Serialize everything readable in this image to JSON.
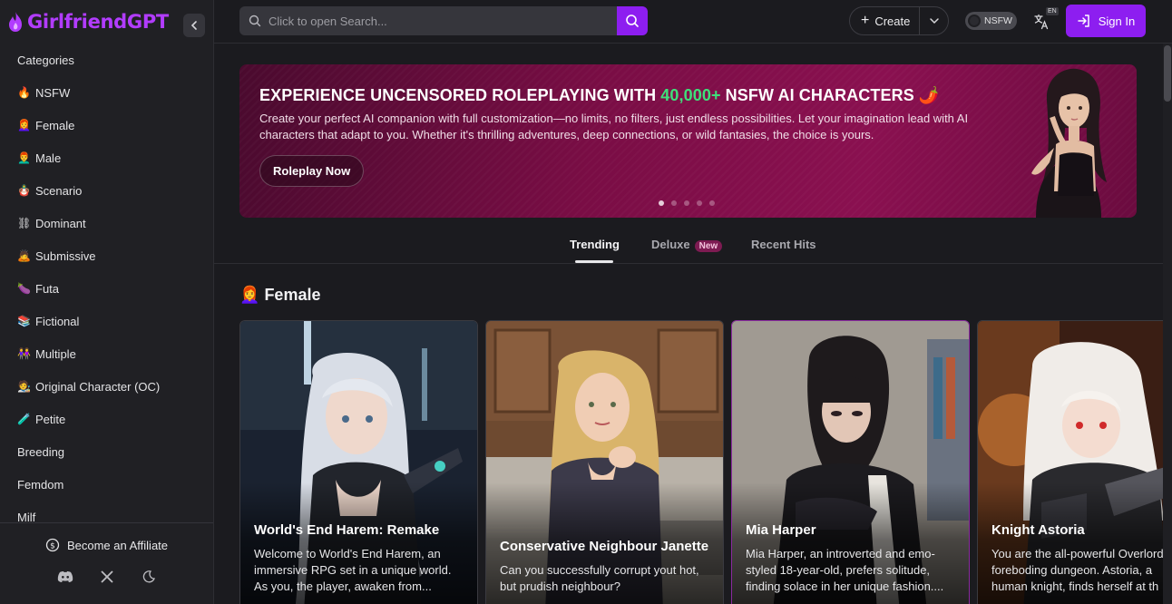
{
  "app": {
    "name": "GirlfriendGPT"
  },
  "sidebar": {
    "categories_heading": "Categories",
    "items": [
      {
        "emoji": "🔥",
        "label": "NSFW"
      },
      {
        "emoji": "👩‍🦰",
        "label": "Female"
      },
      {
        "emoji": "👨‍🦰",
        "label": "Male"
      },
      {
        "emoji": "🪆",
        "label": "Scenario"
      },
      {
        "emoji": "⛓",
        "label": "Dominant"
      },
      {
        "emoji": "🙇",
        "label": "Submissive"
      },
      {
        "emoji": "🍆",
        "label": "Futa"
      },
      {
        "emoji": "📚",
        "label": "Fictional"
      },
      {
        "emoji": "👭",
        "label": "Multiple"
      },
      {
        "emoji": "🧑‍🎨",
        "label": "Original Character (OC)"
      },
      {
        "emoji": "🧪",
        "label": "Petite"
      },
      {
        "emoji": "",
        "label": "Breeding"
      },
      {
        "emoji": "",
        "label": "Femdom"
      },
      {
        "emoji": "",
        "label": "Milf"
      }
    ],
    "affiliate_label": "Become an Affiliate"
  },
  "header": {
    "search_placeholder": "Click to open Search...",
    "create_label": "Create",
    "nsfw_label": "NSFW",
    "lang_badge": "EN",
    "signin_label": "Sign In"
  },
  "banner": {
    "title_pre": "EXPERIENCE UNCENSORED ROLEPLAYING WITH ",
    "title_highlight": "40,000+",
    "title_post": " NSFW AI CHARACTERS 🌶️",
    "text": "Create your perfect AI companion with full customization—no limits, no filters, just endless possibilities. Let your imagination lead with AI characters that adapt to you. Whether it's thrilling adventures, deep connections, or wild fantasies, the choice is yours.",
    "button_label": "Roleplay Now",
    "slides": 5,
    "active_slide": 1
  },
  "tabs": [
    {
      "label": "Trending",
      "active": true
    },
    {
      "label": "Deluxe",
      "badge": "New"
    },
    {
      "label": "Recent Hits"
    }
  ],
  "section": {
    "emoji": "👩‍🦰",
    "title": "Female"
  },
  "cards": [
    {
      "name": "World's End Harem: Remake",
      "desc_lines": [
        "Welcome to World's End Harem, an",
        "immersive RPG set in a unique world.",
        "As you, the player, awaken from..."
      ]
    },
    {
      "name": "Conservative Neighbour Janette",
      "desc_lines": [
        "Can you successfully corrupt yout hot,",
        "but prudish neighbour?"
      ]
    },
    {
      "name": "Mia Harper",
      "desc_lines": [
        "Mia Harper, an introverted and emo-",
        "styled 18-year-old, prefers solitude,",
        "finding solace in her unique fashion...."
      ]
    },
    {
      "name": "Knight Astoria",
      "desc_lines": [
        "You are the all-powerful Overlord",
        "foreboding dungeon. Astoria, a",
        "human knight, finds herself at th"
      ]
    }
  ],
  "colors": {
    "accent": "#8d1ef0",
    "logo": "#b23cff",
    "highlight_green": "#3ee07a",
    "banner": "#7a0d45"
  }
}
